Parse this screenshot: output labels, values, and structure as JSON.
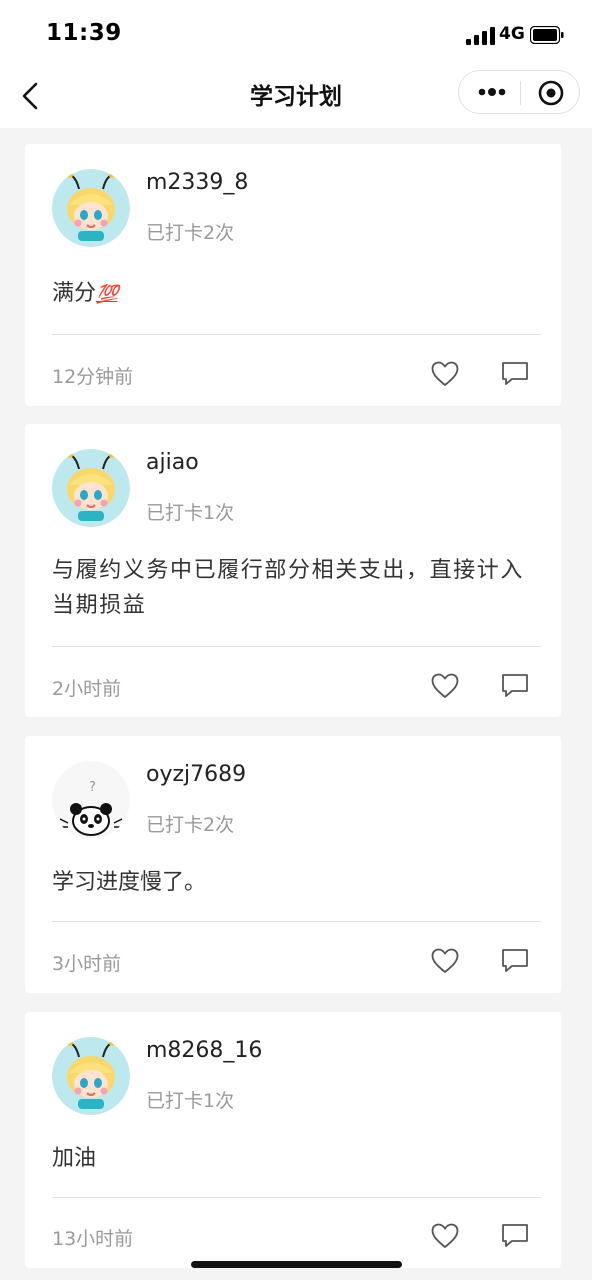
{
  "status_bar": {
    "time": "11:39",
    "network": "4G"
  },
  "header": {
    "title": "学习计划"
  },
  "posts": [
    {
      "username": "m2339_8",
      "checkin": "已打卡2次",
      "content": "满分",
      "emoji": "💯",
      "time": "12分钟前",
      "avatar": "bee-avatar"
    },
    {
      "username": "ajiao",
      "checkin": "已打卡1次",
      "content": "与履约义务中已履行部分相关支出，直接计入当期损益",
      "time": "2小时前",
      "avatar": "bee-avatar"
    },
    {
      "username": "oyzj7689",
      "checkin": "已打卡2次",
      "content": "学习进度慢了。",
      "time": "3小时前",
      "avatar": "panda-avatar"
    },
    {
      "username": "m8268_16",
      "checkin": "已打卡1次",
      "content": "加油",
      "time": "13小时前",
      "avatar": "bee-avatar"
    }
  ],
  "colors": {
    "accent_text": "#333333",
    "muted_text": "#9a9a9a",
    "background": "#f4f4f4"
  }
}
